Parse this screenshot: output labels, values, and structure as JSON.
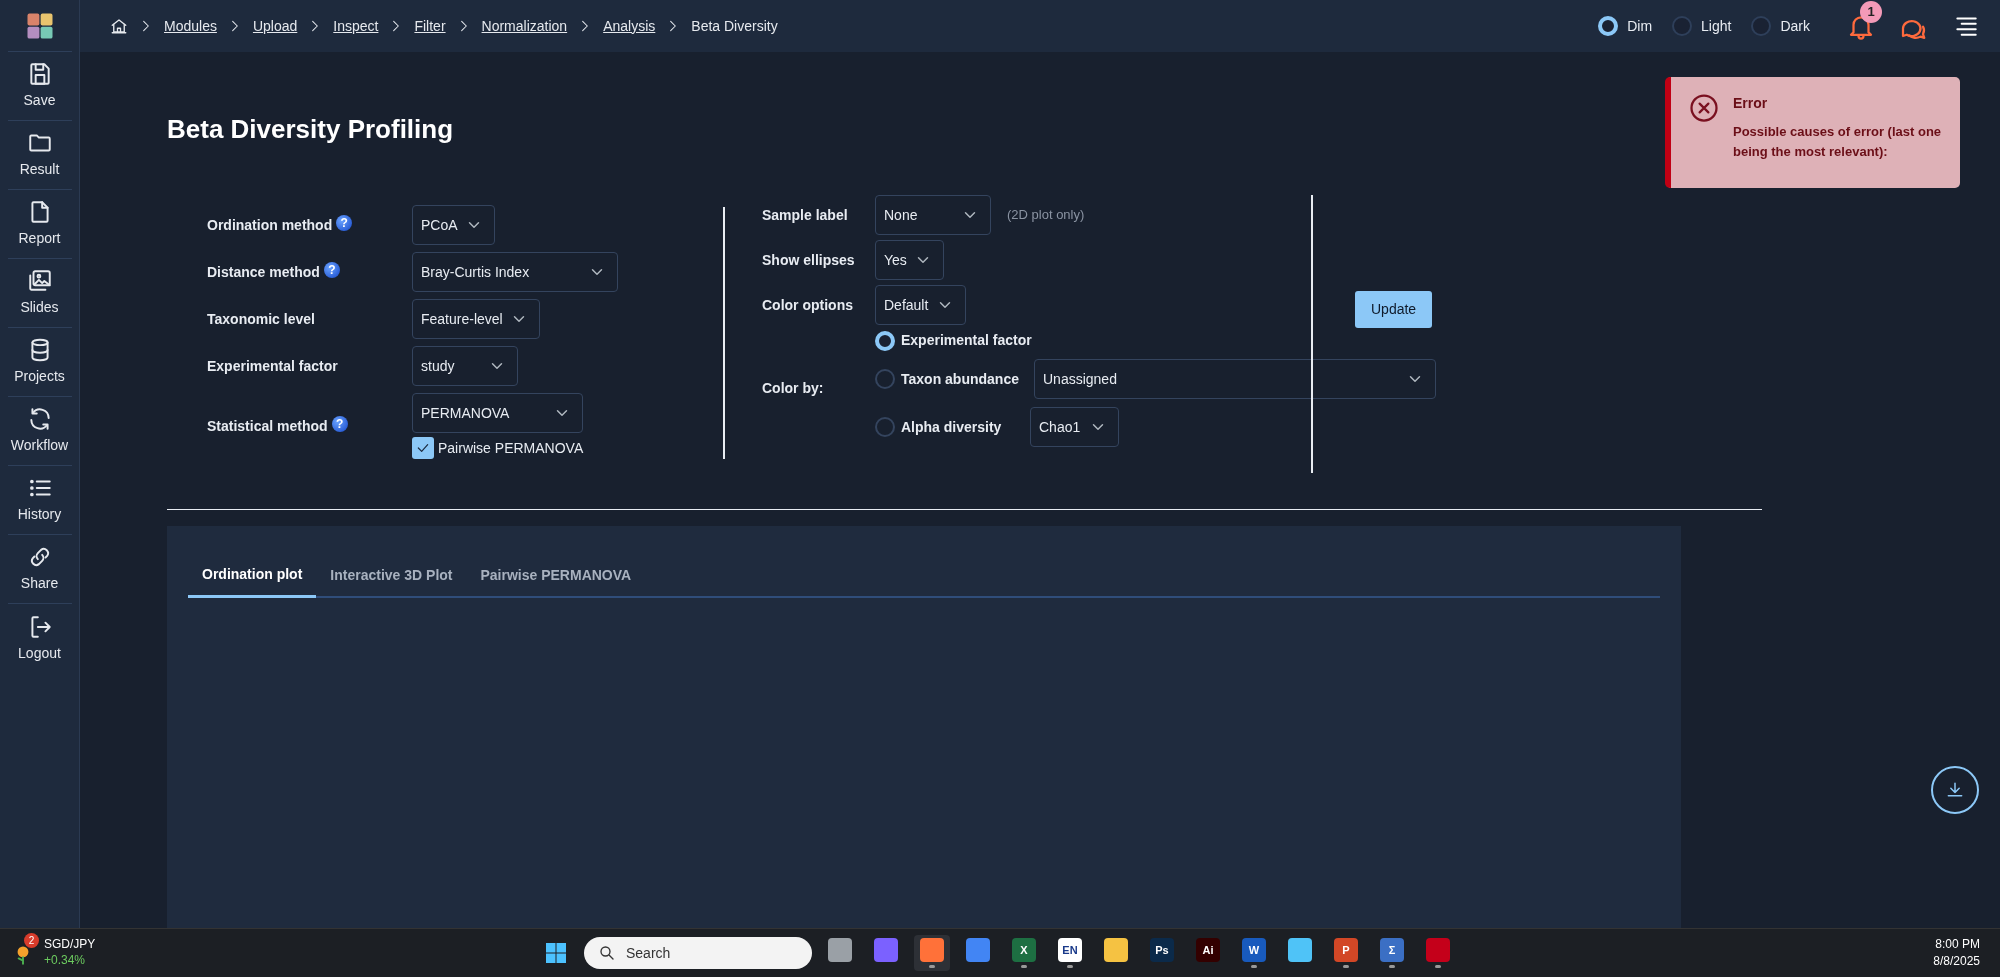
{
  "breadcrumb": [
    {
      "label": "Modules",
      "current": false
    },
    {
      "label": "Upload",
      "current": false
    },
    {
      "label": "Inspect",
      "current": false
    },
    {
      "label": "Filter",
      "current": false
    },
    {
      "label": "Normalization",
      "current": false
    },
    {
      "label": "Analysis",
      "current": false
    },
    {
      "label": "Beta Diversity",
      "current": true
    }
  ],
  "theme_options": [
    {
      "label": "Dim",
      "selected": true
    },
    {
      "label": "Light",
      "selected": false
    },
    {
      "label": "Dark",
      "selected": false
    }
  ],
  "notifications": {
    "badge": "1"
  },
  "sidebar": {
    "items": [
      {
        "label": "Save"
      },
      {
        "label": "Result"
      },
      {
        "label": "Report"
      },
      {
        "label": "Slides"
      },
      {
        "label": "Projects"
      },
      {
        "label": "Workflow"
      },
      {
        "label": "History"
      },
      {
        "label": "Share"
      },
      {
        "label": "Logout"
      }
    ]
  },
  "page_title": "Beta Diversity Profiling",
  "left_form": [
    {
      "label": "Ordination method",
      "help": "?",
      "value": "PCoA"
    },
    {
      "label": "Distance method",
      "help": "?",
      "value": "Bray-Curtis Index"
    },
    {
      "label": "Taxonomic level",
      "value": "Feature-level"
    },
    {
      "label": "Experimental factor",
      "value": "study"
    },
    {
      "label": "Statistical method",
      "help": "?",
      "value": "PERMANOVA",
      "checkbox": {
        "label": "Pairwise PERMANOVA",
        "checked": true
      }
    }
  ],
  "right_form": [
    {
      "label": "Sample label",
      "value": "None",
      "note": "(2D plot only)"
    },
    {
      "label": "Show ellipses",
      "value": "Yes"
    },
    {
      "label": "Color options",
      "value": "Default"
    }
  ],
  "color_by": {
    "label": "Color by:",
    "options": [
      {
        "label": "Experimental factor",
        "selected": true
      },
      {
        "label": "Taxon abundance",
        "selected": false,
        "value": "Unassigned"
      },
      {
        "label": "Alpha diversity",
        "selected": false,
        "value": "Chao1"
      }
    ]
  },
  "update_button": "Update",
  "tabs": [
    {
      "label": "Ordination plot",
      "selected": true
    },
    {
      "label": "Interactive 3D Plot",
      "selected": false
    },
    {
      "label": "Pairwise PERMANOVA",
      "selected": false
    }
  ],
  "toast": {
    "title": "Error",
    "message": "Possible causes of error (last one being the most relevant):"
  },
  "taskbar": {
    "widget": {
      "badge": "2",
      "title": "SGD/JPY",
      "change": "+0.34%"
    },
    "search": "Search",
    "apps": [
      {
        "color": "#9aa0a6",
        "running": false
      },
      {
        "color": "#7b61ff",
        "running": false
      },
      {
        "color": "#ff7139",
        "running": true
      },
      {
        "color": "#4285f4",
        "running": false
      },
      {
        "label": "X",
        "color": "#1d6f42",
        "running": true
      },
      {
        "label": "EN",
        "color": "#ffffff",
        "running": true
      },
      {
        "color": "#f5c242",
        "running": false
      },
      {
        "label": "Ps",
        "color": "#0b2a4a",
        "running": false
      },
      {
        "label": "Ai",
        "color": "#330000",
        "running": false
      },
      {
        "label": "W",
        "color": "#185abd",
        "running": true
      },
      {
        "color": "#4fc3f7",
        "running": false
      },
      {
        "label": "P",
        "color": "#d24726",
        "running": true
      },
      {
        "label": "Σ",
        "color": "#3b6fc4",
        "running": true
      },
      {
        "color": "#c4001a",
        "running": true
      }
    ],
    "time": "8:00 PM",
    "date": "8/8/2025"
  }
}
